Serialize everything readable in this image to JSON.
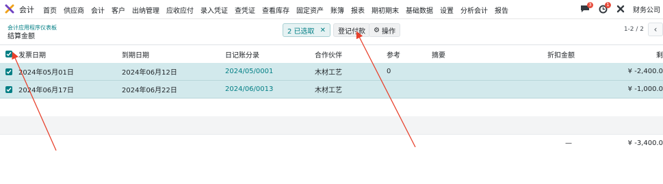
{
  "topbar": {
    "app_name": "会计",
    "menu": [
      "首页",
      "供应商",
      "会计",
      "客户",
      "出纳管理",
      "应收应付",
      "录入凭证",
      "查凭证",
      "查看库存",
      "固定资产",
      "账簿",
      "报表",
      "期初期末",
      "基础数据",
      "设置",
      "分析会计",
      "报告"
    ],
    "chat_count": "3",
    "activity_count": "1",
    "company": "财务公司"
  },
  "control": {
    "breadcrumb": "会计应用程序仪表板",
    "title": "结算金额",
    "selected_label": "2 已选取",
    "register_payment": "登记付款",
    "actions": "操作",
    "pager": "1-2 / 2"
  },
  "table": {
    "headers": {
      "invoice_date": "发票日期",
      "due_date": "到期日期",
      "journal": "日记账分录",
      "partner": "合作伙伴",
      "ref": "参考",
      "memo": "摘要",
      "discount": "折扣金额",
      "residual": "剩"
    },
    "rows": [
      {
        "invoice_date": "2024年05月01日",
        "due_date": "2024年06月12日",
        "journal": "2024/05/0001",
        "partner": "木材工艺",
        "ref": "0",
        "residual": "¥ -2,400.0"
      },
      {
        "invoice_date": "2024年06月17日",
        "due_date": "2024年06月22日",
        "journal": "2024/06/0013",
        "partner": "木材工艺",
        "ref": "",
        "residual": "¥ -1,000.0"
      }
    ],
    "footer": {
      "discount": "—",
      "residual": "¥ -3,400.0"
    }
  },
  "colors": {
    "accent": "#017e84",
    "selected_row": "#d2e9ec",
    "annotation": "#e8412c"
  }
}
